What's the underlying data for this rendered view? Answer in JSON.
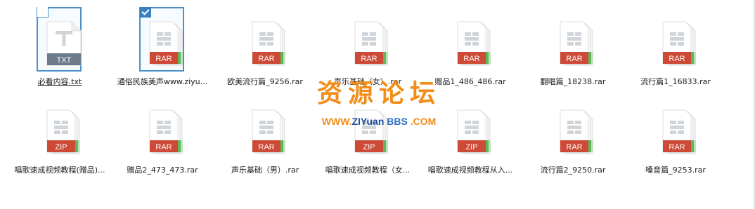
{
  "files": [
    {
      "name": "必看内容.txt",
      "type": "TXT",
      "selected": false,
      "underlined": true
    },
    {
      "name": "通俗民族美声www.ziyu...",
      "type": "RAR",
      "selected": true,
      "underlined": false
    },
    {
      "name": "欧美流行篇_9256.rar",
      "type": "RAR",
      "selected": false,
      "underlined": false
    },
    {
      "name": "声乐基础（女）.rar",
      "type": "RAR",
      "selected": false,
      "underlined": false
    },
    {
      "name": "赠品1_486_486.rar",
      "type": "RAR",
      "selected": false,
      "underlined": false
    },
    {
      "name": "翻唱篇_18238.rar",
      "type": "RAR",
      "selected": false,
      "underlined": false
    },
    {
      "name": "流行篇1_16833.rar",
      "type": "RAR",
      "selected": false,
      "underlined": false
    },
    {
      "name": "唱歌速成视频教程(赠品)...",
      "type": "ZIP",
      "selected": false,
      "underlined": false
    },
    {
      "name": "赠品2_473_473.rar",
      "type": "RAR",
      "selected": false,
      "underlined": false
    },
    {
      "name": "声乐基础（男）.rar",
      "type": "RAR",
      "selected": false,
      "underlined": false
    },
    {
      "name": "唱歌速成视频教程（女...",
      "type": "ZIP",
      "selected": false,
      "underlined": false
    },
    {
      "name": "唱歌速成视频教程从入...",
      "type": "ZIP",
      "selected": false,
      "underlined": false
    },
    {
      "name": "流行篇2_9250.rar",
      "type": "RAR",
      "selected": false,
      "underlined": false
    },
    {
      "name": "嗓音篇_9253.rar",
      "type": "RAR",
      "selected": false,
      "underlined": false
    }
  ],
  "watermark": {
    "title": "资源论坛",
    "url_parts": [
      {
        "text": "WWW.",
        "color": "#f28d19"
      },
      {
        "text": "ZI",
        "color": "#1a4fa0"
      },
      {
        "text": "Yuan",
        "color": "#1a4fa0"
      },
      {
        "text": " BBS",
        "color": "#2f6fc4"
      },
      {
        "text": " .COM",
        "color": "#f28d19"
      }
    ]
  },
  "colors": {
    "selection_border": "#4a90c8",
    "check_fill": "#3a7fc1",
    "txt_band": "#6d7c8c",
    "archive_band": "#cc4a36",
    "archive_edge_green": "#5db85a",
    "page_border": "#dddddd",
    "glyph": "#cfd4d9"
  },
  "icons": {
    "txt": "text-document-icon",
    "archive": "archive-document-icon",
    "check": "checkmark-icon"
  }
}
